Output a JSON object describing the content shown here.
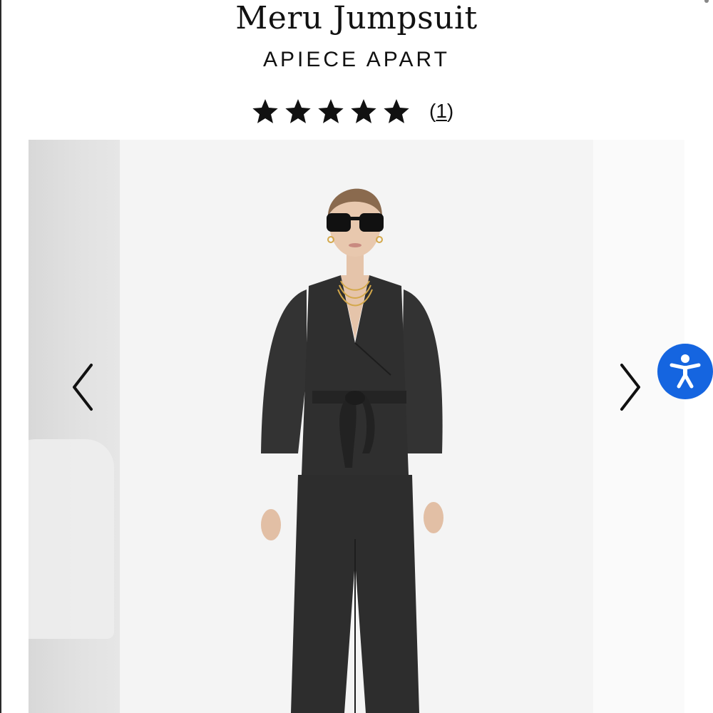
{
  "product": {
    "title": "Meru Jumpsuit",
    "brand": "APIECE APART",
    "rating": {
      "stars": 5,
      "max_stars": 5,
      "review_count_label": "(1)",
      "review_count": "1"
    }
  },
  "gallery": {
    "prev_icon": "chevron-left-icon",
    "next_icon": "chevron-right-icon",
    "image_alt": "Model wearing black Meru Jumpsuit"
  },
  "accessibility": {
    "icon": "accessibility-person-icon",
    "color": "#1565e0"
  },
  "colors": {
    "text": "#111111",
    "jumpsuit": "#2b2b2b",
    "background": "#ffffff"
  }
}
